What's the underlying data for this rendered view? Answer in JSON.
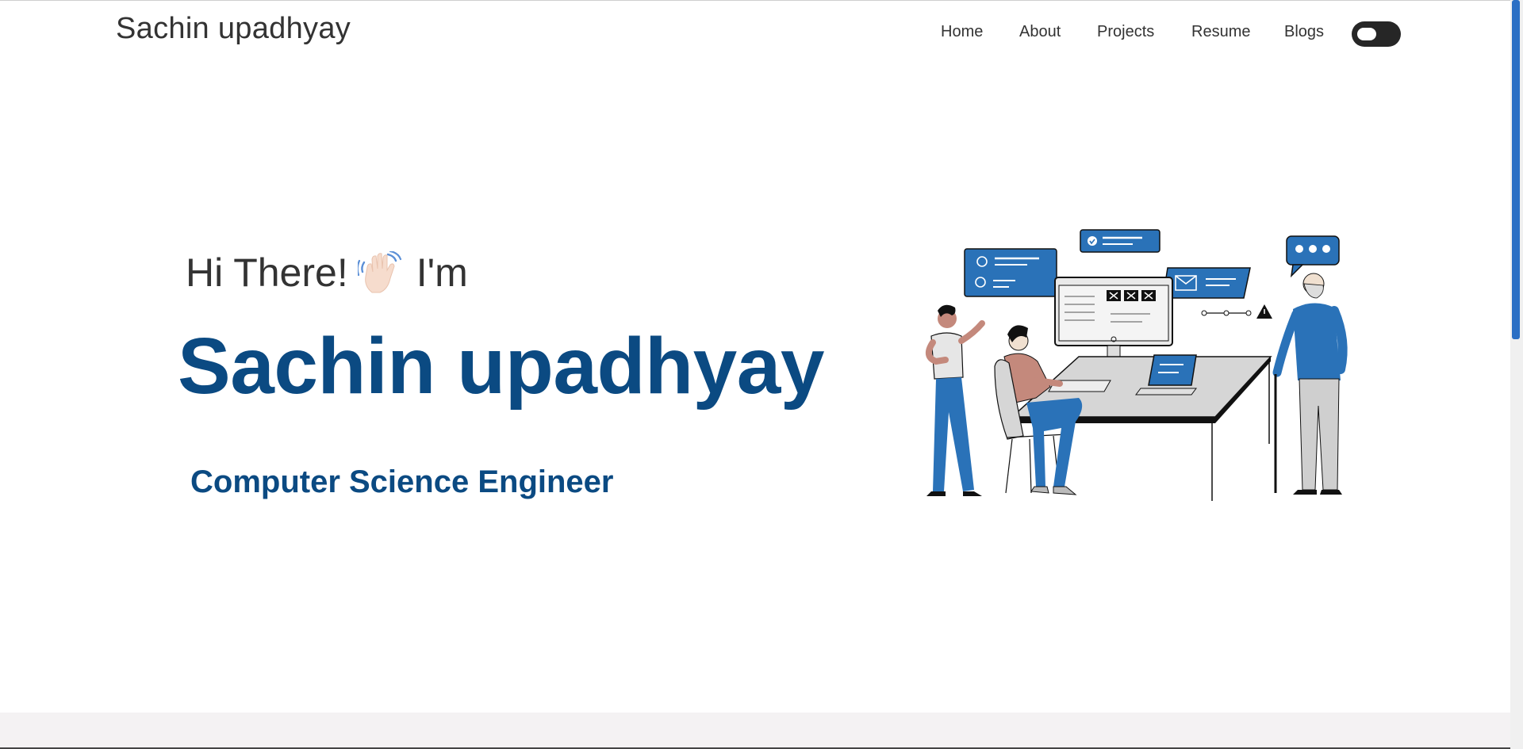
{
  "brand": "Sachin upadhyay",
  "nav": {
    "home": "Home",
    "about": "About",
    "projects": "Projects",
    "resume": "Resume",
    "blogs": "Blogs",
    "theme_toggle": "theme-toggle-switch"
  },
  "hero": {
    "greeting_prefix": "Hi There!",
    "greeting_suffix": "I'm",
    "wave_icon": "waving-hand-icon",
    "name": "Sachin upadhyay",
    "role": "Computer Science Engineer",
    "illustration": "team-working-at-computer-illustration"
  },
  "colors": {
    "accent": "#0b4a82",
    "illustration_blue": "#2a72b8",
    "text": "#333333",
    "scroll_thumb": "#2b6fc4"
  }
}
